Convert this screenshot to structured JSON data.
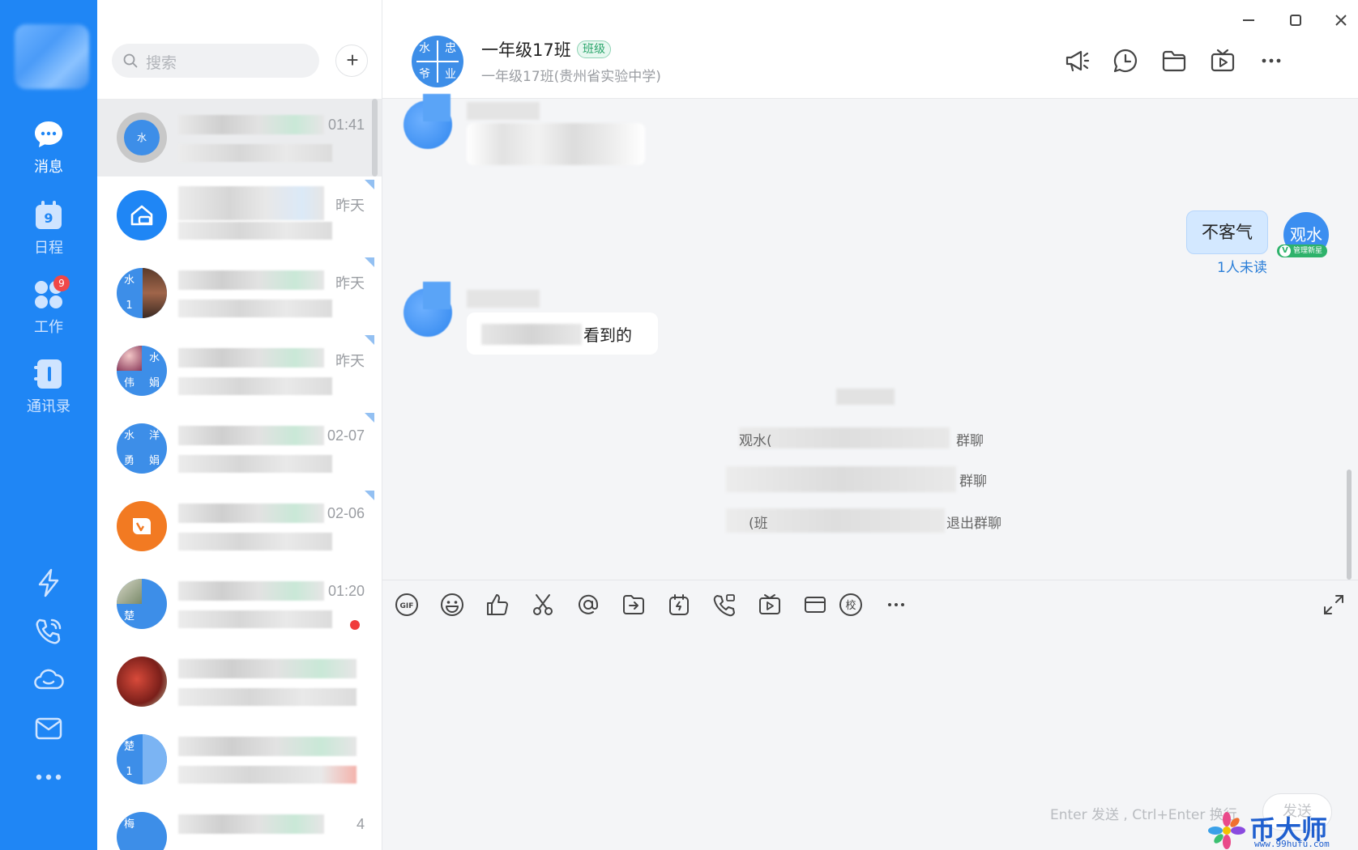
{
  "rail": {
    "items": [
      {
        "label": "消息",
        "icon": "message-icon"
      },
      {
        "label": "日程",
        "icon": "calendar-icon",
        "calendar_day": "9"
      },
      {
        "label": "工作",
        "icon": "apps-icon",
        "badge": "9"
      },
      {
        "label": "通讯录",
        "icon": "contacts-icon"
      }
    ],
    "bottom_icons": [
      "lightning-icon",
      "phone-call-icon",
      "cloud-icon",
      "mail-icon",
      "more-dots-icon"
    ]
  },
  "search": {
    "placeholder": "搜索",
    "add_label": "+"
  },
  "conversations": [
    {
      "time": "01:41",
      "avatar_text": "水"
    },
    {
      "time": "昨天"
    },
    {
      "time": "昨天",
      "avatar_text": [
        "水",
        "1"
      ]
    },
    {
      "time": "昨天",
      "avatar_text": [
        "水",
        "伟",
        "娟"
      ]
    },
    {
      "time": "02-07",
      "avatar_text": [
        "水",
        "洋",
        "勇",
        "娟"
      ]
    },
    {
      "time": "02-06"
    },
    {
      "time": "01:20",
      "avatar_text": "楚"
    },
    {
      "time": ""
    },
    {
      "time": "",
      "avatar_text": [
        "楚",
        "1"
      ]
    },
    {
      "time": "4",
      "avatar_text": [
        "梅"
      ]
    }
  ],
  "chat": {
    "title": "一年级17班",
    "tag": "班级",
    "subtitle": "一年级17班(贵州省实验中学)",
    "group_avatar": [
      "水",
      "忠",
      "爷",
      "业"
    ],
    "header_icons": [
      "megaphone-icon",
      "clock-bubble-icon",
      "folder-icon",
      "live-video-icon",
      "more-icon"
    ],
    "messages": {
      "partial_incoming_text": "看到的",
      "outgoing_text": "不客气",
      "unread_label": "1人未读",
      "my_avatar_text": "观水",
      "my_badge": "管理新星"
    },
    "system_lines": [
      "观水(",
      "群聊",
      "群聊",
      "(班",
      "退出群聊"
    ],
    "toolbar": [
      "gif-icon",
      "emoji-icon",
      "thumbs-up-icon",
      "scissors-icon",
      "at-icon",
      "file-send-icon",
      "flash-note-icon",
      "voice-call-icon",
      "video-live-icon",
      "mail-icon",
      "school-icon",
      "more-dots-icon"
    ],
    "gif_label": "GIF",
    "school_label": "校",
    "send_hint": "Enter 发送 , Ctrl+Enter 换行",
    "send_label": "发送"
  },
  "watermark": {
    "text": "币大师",
    "url": "www.99hufu.com"
  },
  "colors": {
    "rail": "#1f86f5",
    "accent": "#3b8ef0",
    "tag_green": "#2aa56b"
  }
}
